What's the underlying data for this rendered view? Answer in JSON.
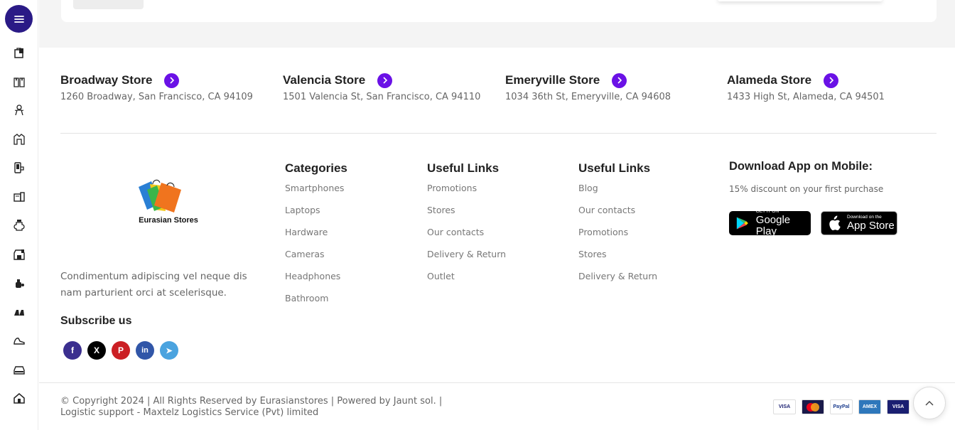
{
  "stores": [
    {
      "name": "Broadway Store",
      "address": "1260 Broadway, San Francisco, CA 94109"
    },
    {
      "name": "Valencia Store",
      "address": "1501 Valencia St, San Francisco, CA 94110"
    },
    {
      "name": "Emeryville Store",
      "address": "1034 36th St, Emeryville, CA 94608"
    },
    {
      "name": "Alameda Store",
      "address": "1433 High St, Alameda, CA 94501"
    }
  ],
  "brand": {
    "logo_text": "Eurasian Stores",
    "about": "Condimentum adipiscing vel neque dis nam parturient orci at scelerisque.",
    "subscribe_title": "Subscribe us"
  },
  "socials": [
    {
      "name": "facebook",
      "glyph": "f",
      "color": "#3b2f8f"
    },
    {
      "name": "x",
      "glyph": "X",
      "color": "#000000"
    },
    {
      "name": "pinterest",
      "glyph": "P",
      "color": "#cb1f24"
    },
    {
      "name": "linkedin",
      "glyph": "in",
      "color": "#3156a8"
    },
    {
      "name": "telegram",
      "glyph": "➤",
      "color": "#4aa3df"
    }
  ],
  "columns": {
    "categories": {
      "title": "Categories",
      "items": [
        "Smartphones",
        "Laptops",
        "Hardware",
        "Cameras",
        "Headphones",
        "Bathroom"
      ]
    },
    "useful_links_1": {
      "title": "Useful Links",
      "items": [
        "Promotions",
        "Stores",
        "Our contacts",
        "Delivery & Return",
        "Outlet"
      ]
    },
    "useful_links_2": {
      "title": "Useful Links",
      "items": [
        "Blog",
        "Our contacts",
        "Promotions",
        "Stores",
        "Delivery & Return"
      ]
    }
  },
  "app": {
    "title": "Download App on Mobile:",
    "subtitle": "15% discount on your first purchase",
    "google_small": "GET IT ON",
    "google_big": "Google Play",
    "apple_small": "Download on the",
    "apple_big": "App Store"
  },
  "copyright": "© Copyright 2024 | All Rights Reserved by Eurasianstores | Powered by Jaunt sol. | Logistic support - Maxtelz Logistics Service (Pvt) limited",
  "payments": [
    {
      "name": "visa",
      "label": "VISA",
      "color": "#1a1f71",
      "bg": "#ffffff"
    },
    {
      "name": "mastercard",
      "label": "MC",
      "color": "#ffffff",
      "bg": "#1a1a4a"
    },
    {
      "name": "paypal",
      "label": "PayPal",
      "color": "#1a3b8c",
      "bg": "#ffffff"
    },
    {
      "name": "amex",
      "label": "AMEX",
      "color": "#ffffff",
      "bg": "#2e77bb"
    },
    {
      "name": "visa-electron",
      "label": "VISA",
      "color": "#ffffff",
      "bg": "#1a1f71"
    }
  ],
  "sidebar_icons": [
    "bags-icon",
    "clothing-icon",
    "baby-icon",
    "jacket-icon",
    "phone-icon",
    "appliance-icon",
    "jar-icon",
    "store-icon",
    "perfume-icon",
    "shoes-icon",
    "sneaker-icon",
    "car-icon",
    "home-icon"
  ]
}
